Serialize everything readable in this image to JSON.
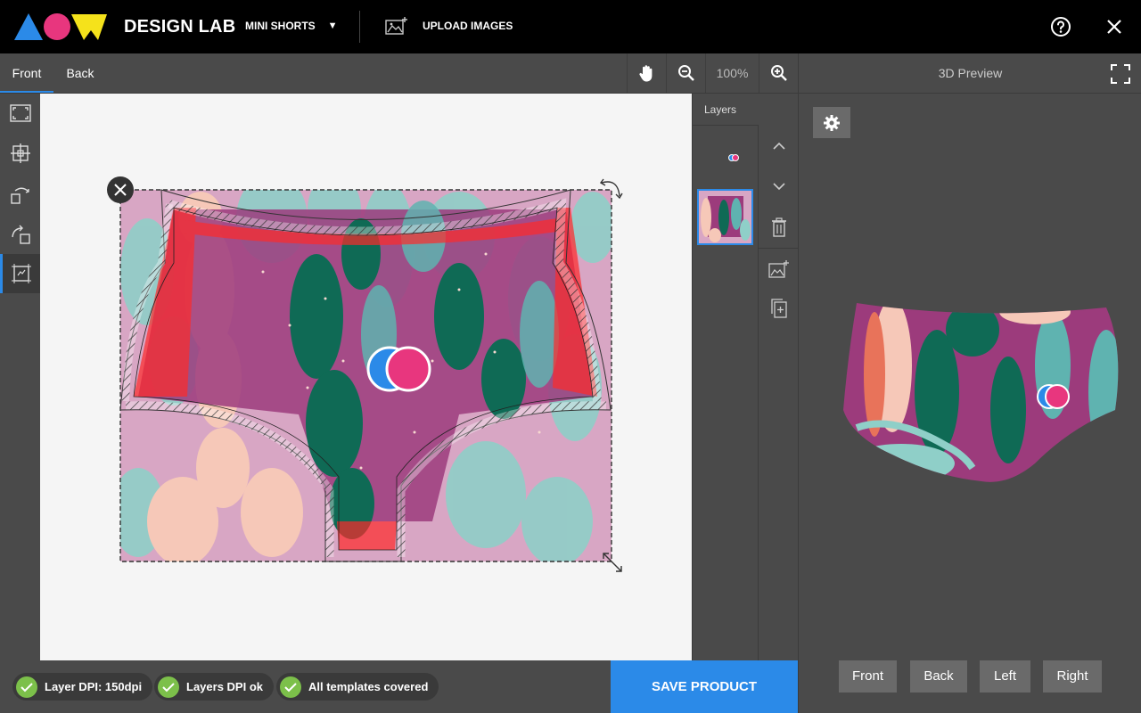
{
  "app": {
    "brand": "DESIGN LAB",
    "product_name": "MINI SHORTS",
    "product_caret": "▼",
    "upload_label": "UPLOAD IMAGES",
    "help_icon": "help-circle-icon",
    "close_icon": "close-icon",
    "logo_colors": {
      "triangle": "#2b8ae8",
      "circle": "#e8367e",
      "w": "#f5e21b"
    }
  },
  "toolbar": {
    "tabs": [
      {
        "label": "Front",
        "active": true
      },
      {
        "label": "Back",
        "active": false
      }
    ],
    "zoom_level": "100%",
    "tools": [
      "hand-icon",
      "zoom-out-icon",
      "zoom-in-icon"
    ]
  },
  "left_tools": [
    {
      "icon": "fit-frame-icon",
      "active": false
    },
    {
      "icon": "center-crosshair-icon",
      "active": false
    },
    {
      "icon": "rotate-left-icon",
      "active": false
    },
    {
      "icon": "rotate-right-icon",
      "active": false
    },
    {
      "icon": "fill-area-icon",
      "active": true
    }
  ],
  "layers": {
    "title": "Layers",
    "items": [
      {
        "name": "logo-layer",
        "selected": false
      },
      {
        "name": "pattern-layer",
        "selected": true
      }
    ],
    "actions": [
      "move-up-icon",
      "move-down-icon",
      "trash-icon",
      "add-image-icon",
      "duplicate-icon"
    ]
  },
  "preview": {
    "title": "3D Preview",
    "views": [
      "Front",
      "Back",
      "Left",
      "Right"
    ]
  },
  "status": {
    "badges": [
      "Layer DPI: 150dpi",
      "Layers DPI ok",
      "All templates covered"
    ],
    "ok_color": "#7cc04a"
  },
  "save_label": "SAVE PRODUCT",
  "accent_color": "#2b8ae8"
}
